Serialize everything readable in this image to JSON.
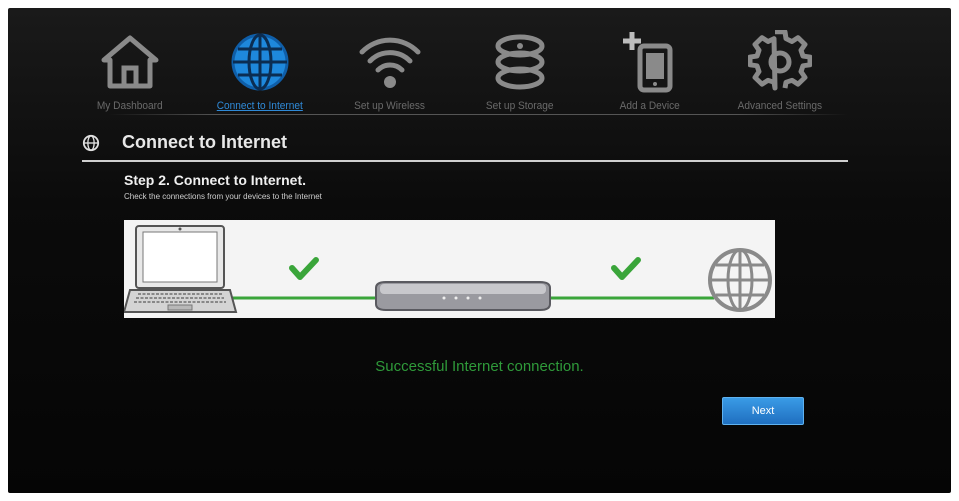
{
  "nav": {
    "items": [
      {
        "label": "My Dashboard",
        "icon": "home-icon"
      },
      {
        "label": "Connect to Internet",
        "icon": "globe-icon",
        "active": true
      },
      {
        "label": "Set up Wireless",
        "icon": "wifi-icon"
      },
      {
        "label": "Set up Storage",
        "icon": "storage-icon"
      },
      {
        "label": "Add a Device",
        "icon": "add-device-icon"
      },
      {
        "label": "Advanced Settings",
        "icon": "gear-icon"
      }
    ]
  },
  "page": {
    "title": "Connect to Internet",
    "title_icon": "globe-icon"
  },
  "step": {
    "title": "Step 2. Connect to Internet.",
    "subtitle": "Check the connections from your devices to the Internet"
  },
  "diagram": {
    "nodes": [
      "laptop-icon",
      "router-icon",
      "globe-icon"
    ],
    "links": [
      {
        "status": "ok",
        "icon": "checkmark-icon"
      },
      {
        "status": "ok",
        "icon": "checkmark-icon"
      }
    ]
  },
  "status": {
    "message": "Successful Internet connection."
  },
  "actions": {
    "next_label": "Next"
  },
  "colors": {
    "accent": "#2f8ad8",
    "success": "#2f9a3a",
    "background": "#0b0b0b"
  }
}
